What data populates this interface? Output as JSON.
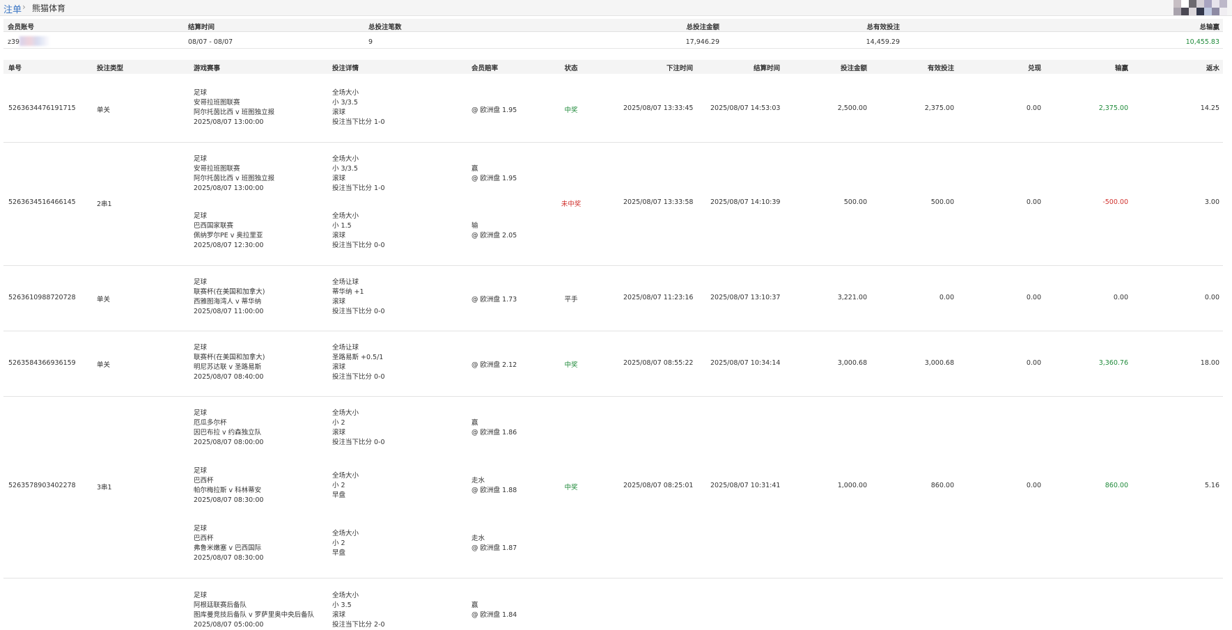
{
  "breadcrumb": {
    "root": "注单",
    "separator": "›",
    "current": "熊猫体育"
  },
  "summary": {
    "headers": {
      "member": "会员账号",
      "settle_time": "结算时间",
      "total_count": "总投注笔数",
      "total_amount": "总投注金额",
      "total_valid": "总有效投注",
      "total_winloss": "总输赢"
    },
    "values": {
      "member": "z39",
      "settle_time": "08/07 - 08/07",
      "total_count": "9",
      "total_amount": "17,946.29",
      "total_valid": "14,459.29",
      "total_winloss": "10,455.83"
    }
  },
  "columns": {
    "order_no": "单号",
    "bet_type": "投注类型",
    "event": "游戏赛事",
    "detail": "投注详情",
    "odds": "会员赔率",
    "status": "状态",
    "bet_time": "下注时间",
    "settle_time": "结算时间",
    "amount": "投注金额",
    "valid": "有效投注",
    "cashout": "兑现",
    "winloss": "输赢",
    "rebate": "返水"
  },
  "rows": [
    {
      "order_no": "5263634476191715",
      "bet_type": "单关",
      "status": "中奖",
      "status_kind": "win",
      "bet_time": "2025/08/07 13:33:45",
      "settle_time": "2025/08/07 14:53:03",
      "amount": "2,500.00",
      "valid": "2,375.00",
      "cashout": "0.00",
      "winloss": "2,375.00",
      "winloss_kind": "pos",
      "rebate": "14.25",
      "legs": [
        {
          "sport": "足球",
          "league": "安哥拉班图联赛",
          "match": "阿尔托茵比西 v 班图独立报",
          "time": "2025/08/07 13:00:00",
          "market": "全场大小",
          "selection": "小 3/3.5",
          "mode": "滚球",
          "score": "投注当下比分 1-0",
          "result": "",
          "odds": "@ 欧洲盘 1.95"
        }
      ]
    },
    {
      "order_no": "5263634516466145",
      "bet_type": "2串1",
      "status": "未中奖",
      "status_kind": "lose",
      "bet_time": "2025/08/07 13:33:58",
      "settle_time": "2025/08/07 14:10:39",
      "amount": "500.00",
      "valid": "500.00",
      "cashout": "0.00",
      "winloss": "-500.00",
      "winloss_kind": "neg",
      "rebate": "3.00",
      "legs": [
        {
          "sport": "足球",
          "league": "安哥拉班图联赛",
          "match": "阿尔托茵比西 v 班图独立报",
          "time": "2025/08/07 13:00:00",
          "market": "全场大小",
          "selection": "小 3/3.5",
          "mode": "滚球",
          "score": "投注当下比分 1-0",
          "result": "赢",
          "odds": "@ 欧洲盘 1.95"
        },
        {
          "sport": "足球",
          "league": "巴西国家联赛",
          "match": "佩纳罗尔PE v 奥拉里亚",
          "time": "2025/08/07 12:30:00",
          "market": "全场大小",
          "selection": "小 1.5",
          "mode": "滚球",
          "score": "投注当下比分 0-0",
          "result": "输",
          "odds": "@ 欧洲盘 2.05"
        }
      ]
    },
    {
      "order_no": "5263610988720728",
      "bet_type": "单关",
      "status": "平手",
      "status_kind": "push",
      "bet_time": "2025/08/07 11:23:16",
      "settle_time": "2025/08/07 13:10:37",
      "amount": "3,221.00",
      "valid": "0.00",
      "cashout": "0.00",
      "winloss": "0.00",
      "winloss_kind": "neutral",
      "rebate": "0.00",
      "legs": [
        {
          "sport": "足球",
          "league": "联赛杯(在美国和加拿大)",
          "match": "西雅图海湾人 v 蒂华纳",
          "time": "2025/08/07 11:00:00",
          "market": "全场让球",
          "selection": "蒂华纳 +1",
          "mode": "滚球",
          "score": "投注当下比分 0-0",
          "result": "",
          "odds": "@ 欧洲盘 1.73"
        }
      ]
    },
    {
      "order_no": "5263584366936159",
      "bet_type": "单关",
      "status": "中奖",
      "status_kind": "win",
      "bet_time": "2025/08/07 08:55:22",
      "settle_time": "2025/08/07 10:34:14",
      "amount": "3,000.68",
      "valid": "3,000.68",
      "cashout": "0.00",
      "winloss": "3,360.76",
      "winloss_kind": "pos",
      "rebate": "18.00",
      "legs": [
        {
          "sport": "足球",
          "league": "联赛杯(在美国和加拿大)",
          "match": "明尼苏达联 v 圣路易斯",
          "time": "2025/08/07 08:40:00",
          "market": "全场让球",
          "selection": "圣路易斯 +0.5/1",
          "mode": "滚球",
          "score": "投注当下比分 0-0",
          "result": "",
          "odds": "@ 欧洲盘 2.12"
        }
      ]
    },
    {
      "order_no": "5263578903402278",
      "bet_type": "3串1",
      "status": "中奖",
      "status_kind": "win",
      "bet_time": "2025/08/07 08:25:01",
      "settle_time": "2025/08/07 10:31:41",
      "amount": "1,000.00",
      "valid": "860.00",
      "cashout": "0.00",
      "winloss": "860.00",
      "winloss_kind": "pos",
      "rebate": "5.16",
      "legs": [
        {
          "sport": "足球",
          "league": "厄瓜多尔杯",
          "match": "因巴布拉 v 约森独立队",
          "time": "2025/08/07 08:00:00",
          "market": "全场大小",
          "selection": "小 2",
          "mode": "滚球",
          "score": "投注当下比分 0-0",
          "result": "赢",
          "odds": "@ 欧洲盘 1.86"
        },
        {
          "sport": "足球",
          "league": "巴西杯",
          "match": "帕尔梅拉斯 v 科林蒂安",
          "time": "2025/08/07 08:30:00",
          "market": "全场大小",
          "selection": "小 2",
          "mode": "早盘",
          "score": "",
          "result": "走水",
          "odds": "@ 欧洲盘 1.88"
        },
        {
          "sport": "足球",
          "league": "巴西杯",
          "match": "弗鲁米嫩塞 v 巴西国际",
          "time": "2025/08/07 08:30:00",
          "market": "全场大小",
          "selection": "小 2",
          "mode": "早盘",
          "score": "",
          "result": "走水",
          "odds": "@ 欧洲盘 1.87"
        }
      ]
    },
    {
      "order_no": "",
      "bet_type": "",
      "status": "",
      "status_kind": "",
      "bet_time": "",
      "settle_time": "",
      "amount": "",
      "valid": "",
      "cashout": "",
      "winloss": "",
      "winloss_kind": "",
      "rebate": "",
      "legs": [
        {
          "sport": "足球",
          "league": "阿根廷联赛后备队",
          "match": "图库曼竞技后备队 v 罗萨里奥中央后备队",
          "time": "2025/08/07 05:00:00",
          "market": "全场大小",
          "selection": "小 3.5",
          "mode": "滚球",
          "score": "投注当下比分 2-0",
          "result": "赢",
          "odds": "@ 欧洲盘 1.84"
        }
      ]
    }
  ]
}
